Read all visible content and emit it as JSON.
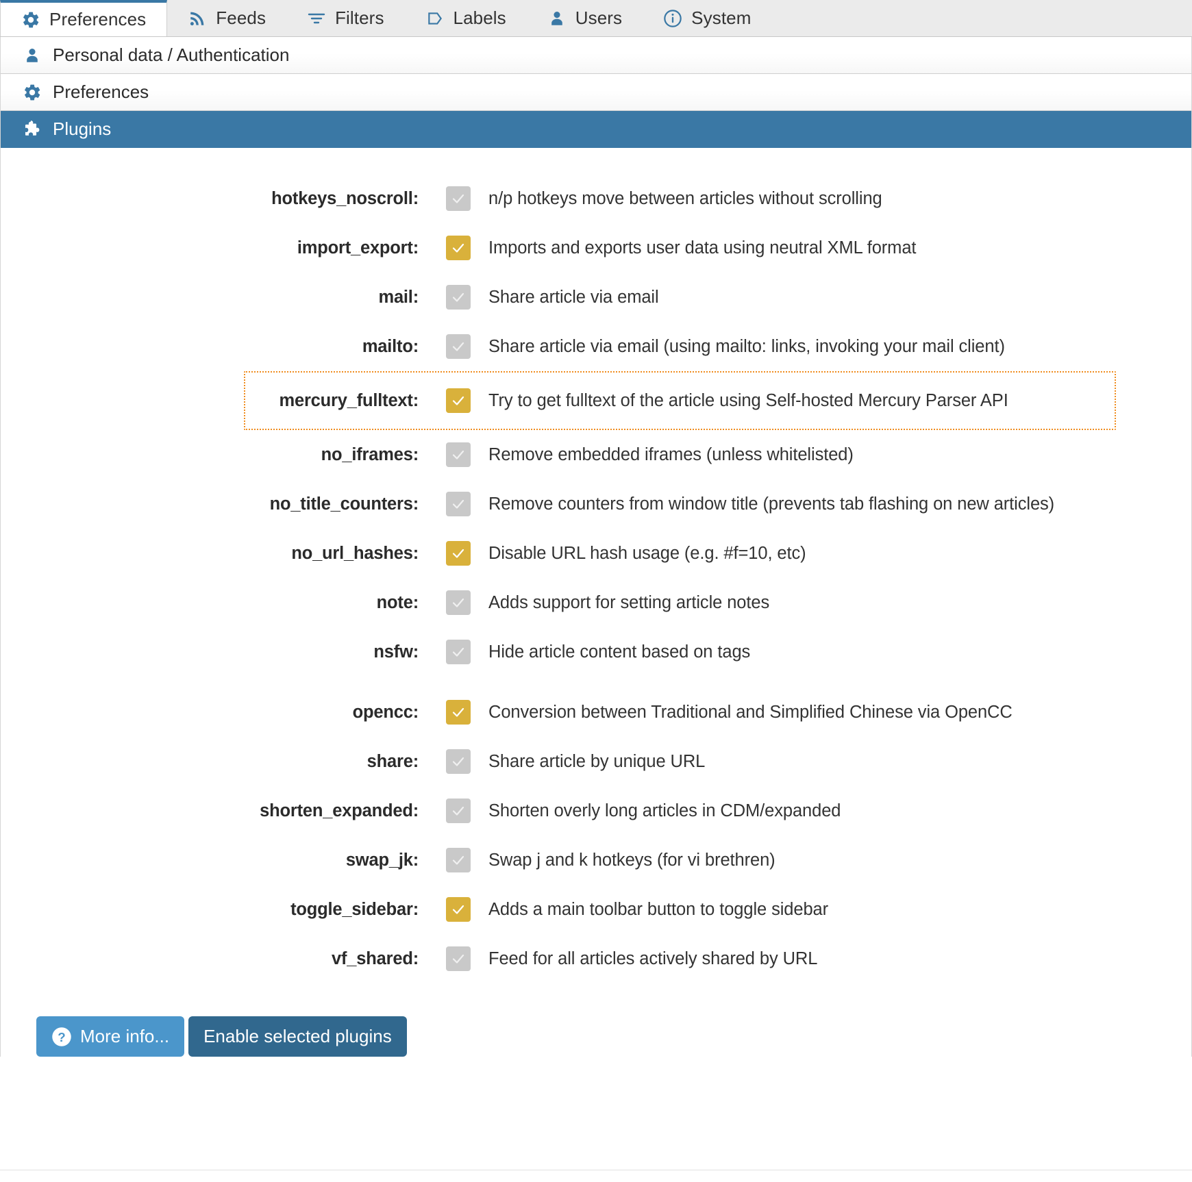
{
  "tabs": [
    {
      "label": "Preferences",
      "icon": "gear-icon",
      "active": true
    },
    {
      "label": "Feeds",
      "icon": "rss-icon",
      "active": false
    },
    {
      "label": "Filters",
      "icon": "filter-icon",
      "active": false
    },
    {
      "label": "Labels",
      "icon": "tag-icon",
      "active": false
    },
    {
      "label": "Users",
      "icon": "user-icon",
      "active": false
    },
    {
      "label": "System",
      "icon": "info-icon",
      "active": false
    }
  ],
  "sections": [
    {
      "label": "Personal data / Authentication",
      "icon": "user-icon",
      "selected": false
    },
    {
      "label": "Preferences",
      "icon": "gear-icon",
      "selected": false
    },
    {
      "label": "Plugins",
      "icon": "puzzle-icon",
      "selected": true
    }
  ],
  "plugins": [
    {
      "name": "hotkeys_noscroll:",
      "desc": "n/p hotkeys move between articles without scrolling",
      "checked": false,
      "highlighted": false,
      "gap_before": false
    },
    {
      "name": "import_export:",
      "desc": "Imports and exports user data using neutral XML format",
      "checked": true,
      "highlighted": false,
      "gap_before": false
    },
    {
      "name": "mail:",
      "desc": "Share article via email",
      "checked": false,
      "highlighted": false,
      "gap_before": false
    },
    {
      "name": "mailto:",
      "desc": "Share article via email (using mailto: links, invoking your mail client)",
      "checked": false,
      "highlighted": false,
      "gap_before": false
    },
    {
      "name": "mercury_fulltext:",
      "desc": "Try to get fulltext of the article using Self-hosted Mercury Parser API",
      "checked": true,
      "highlighted": true,
      "gap_before": false
    },
    {
      "name": "no_iframes:",
      "desc": "Remove embedded iframes (unless whitelisted)",
      "checked": false,
      "highlighted": false,
      "gap_before": false
    },
    {
      "name": "no_title_counters:",
      "desc": "Remove counters from window title (prevents tab flashing on new articles)",
      "checked": false,
      "highlighted": false,
      "gap_before": false
    },
    {
      "name": "no_url_hashes:",
      "desc": "Disable URL hash usage (e.g. #f=10, etc)",
      "checked": true,
      "highlighted": false,
      "gap_before": false
    },
    {
      "name": "note:",
      "desc": "Adds support for setting article notes",
      "checked": false,
      "highlighted": false,
      "gap_before": false
    },
    {
      "name": "nsfw:",
      "desc": "Hide article content based on tags",
      "checked": false,
      "highlighted": false,
      "gap_before": false
    },
    {
      "name": "opencc:",
      "desc": "Conversion between Traditional and Simplified Chinese via OpenCC",
      "checked": true,
      "highlighted": false,
      "gap_before": true
    },
    {
      "name": "share:",
      "desc": "Share article by unique URL",
      "checked": false,
      "highlighted": false,
      "gap_before": false
    },
    {
      "name": "shorten_expanded:",
      "desc": "Shorten overly long articles in CDM/expanded",
      "checked": false,
      "highlighted": false,
      "gap_before": false
    },
    {
      "name": "swap_jk:",
      "desc": "Swap j and k hotkeys (for vi brethren)",
      "checked": false,
      "highlighted": false,
      "gap_before": false
    },
    {
      "name": "toggle_sidebar:",
      "desc": "Adds a main toolbar button to toggle sidebar",
      "checked": true,
      "highlighted": false,
      "gap_before": false
    },
    {
      "name": "vf_shared:",
      "desc": "Feed for all articles actively shared by URL",
      "checked": false,
      "highlighted": false,
      "gap_before": false
    }
  ],
  "buttons": {
    "more_info": "More info...",
    "more_info_icon": "question-circle-icon",
    "enable_selected": "Enable selected plugins"
  },
  "colors": {
    "accent_blue": "#3a78a5",
    "checkbox_on": "#d9b13b",
    "checkbox_off": "#c9c9c9",
    "highlight_orange": "#f08c1e",
    "button_light": "#4b96cb",
    "button_dark": "#31688e"
  }
}
